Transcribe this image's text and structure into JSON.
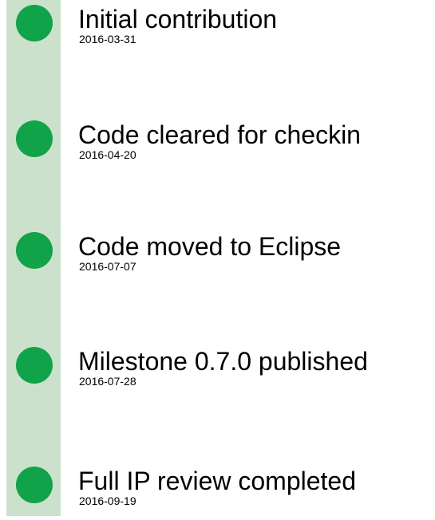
{
  "timeline": {
    "events": [
      {
        "title": "Initial contribution",
        "date": "2016-03-31"
      },
      {
        "title": "Code cleared for checkin",
        "date": "2016-04-20"
      },
      {
        "title": "Code moved to Eclipse",
        "date": "2016-07-07"
      },
      {
        "title": "Milestone 0.7.0 published",
        "date": "2016-07-28"
      },
      {
        "title": "Full IP review completed",
        "date": "2016-09-19"
      }
    ],
    "colors": {
      "rail": "#cce1cc",
      "marker": "#10a34a",
      "text": "#000000"
    }
  }
}
